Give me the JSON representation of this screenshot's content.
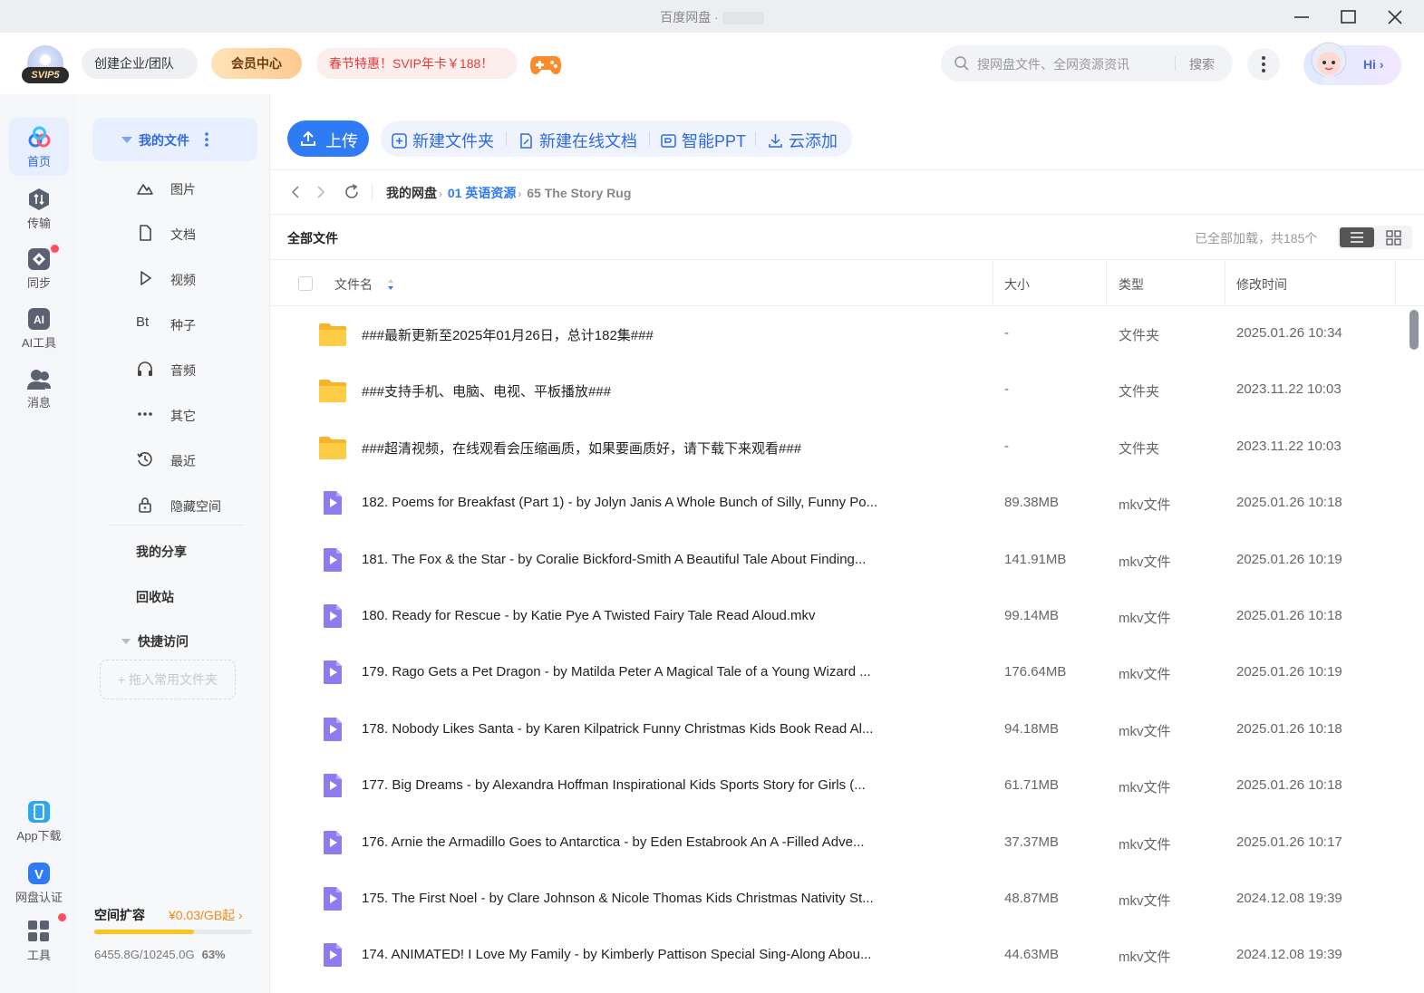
{
  "window": {
    "title": "百度网盘 ·",
    "controls": [
      "minimize-icon",
      "maximize-icon",
      "close-icon"
    ]
  },
  "header": {
    "svip_label": "SVIP5",
    "create_team": "创建企业/团队",
    "vip_center": "会员中心",
    "promo": "春节特惠！SVIP年卡￥188！",
    "search_placeholder": "搜网盘文件、全网资源资讯",
    "search_button": "搜索",
    "hi_label": "Hi"
  },
  "rail": {
    "items": [
      {
        "label": "首页",
        "icon": "home-icon"
      },
      {
        "label": "传输",
        "icon": "transfer-icon"
      },
      {
        "label": "同步",
        "icon": "sync-icon"
      },
      {
        "label": "AI工具",
        "icon": "ai-tools-icon"
      },
      {
        "label": "消息",
        "icon": "messages-icon"
      }
    ],
    "bottom": [
      {
        "label": "App下载",
        "icon": "app-download-icon"
      },
      {
        "label": "网盘认证",
        "icon": "verify-icon"
      },
      {
        "label": "工具",
        "icon": "tools-icon"
      }
    ]
  },
  "nav": {
    "my_files": "我的文件",
    "items": [
      {
        "label": "图片",
        "icon": "image-icon"
      },
      {
        "label": "文档",
        "icon": "document-icon"
      },
      {
        "label": "视频",
        "icon": "video-icon"
      },
      {
        "label": "种子",
        "icon": "torrent-icon"
      },
      {
        "label": "音频",
        "icon": "audio-icon"
      },
      {
        "label": "其它",
        "icon": "other-icon"
      },
      {
        "label": "最近",
        "icon": "recent-icon"
      },
      {
        "label": "隐藏空间",
        "icon": "lock-icon"
      }
    ],
    "torrent_glyph": "Bt",
    "my_share": "我的分享",
    "recycle": "回收站",
    "quick_access": "快捷访问",
    "drop_hint": "+ 拖入常用文件夹",
    "space": {
      "title": "空间扩容",
      "price": "¥0.03/GB起",
      "usage": "6455.8G/10245.0G",
      "percent_label": "63%",
      "percent": 63
    }
  },
  "toolbar": {
    "upload": "上传",
    "new_folder": "新建文件夹",
    "new_doc": "新建在线文档",
    "smart_ppt": "智能PPT",
    "cloud_add": "云添加"
  },
  "breadcrumb": {
    "root": "我的网盘",
    "level1": "01 英语资源",
    "current": "65 The Story Rug"
  },
  "list": {
    "title": "全部文件",
    "count": "已全部加载，共185个",
    "columns": {
      "name": "文件名",
      "size": "大小",
      "type": "类型",
      "modified": "修改时间"
    },
    "rows": [
      {
        "kind": "folder",
        "name": "###最新更新至2025年01月26日，总计182集###",
        "size": "-",
        "type": "文件夹",
        "modified": "2025.01.26 10:34"
      },
      {
        "kind": "folder",
        "name": "###支持手机、电脑、电视、平板播放###",
        "size": "-",
        "type": "文件夹",
        "modified": "2023.11.22 10:03"
      },
      {
        "kind": "folder",
        "name": "###超清视频，在线观看会压缩画质，如果要画质好，请下载下来观看###",
        "size": "-",
        "type": "文件夹",
        "modified": "2023.11.22 10:03"
      },
      {
        "kind": "video",
        "name": "182. Poems for Breakfast (Part 1) - by Jolyn Janis A Whole Bunch of Silly, Funny Po...",
        "size": "89.38MB",
        "type": "mkv文件",
        "modified": "2025.01.26 10:18"
      },
      {
        "kind": "video",
        "name": "181. The Fox & the Star - by Coralie Bickford-Smith A Beautiful Tale About Finding...",
        "size": "141.91MB",
        "type": "mkv文件",
        "modified": "2025.01.26 10:19"
      },
      {
        "kind": "video",
        "name": "180. Ready for Rescue - by Katie Pye A Twisted Fairy Tale Read Aloud.mkv",
        "size": "99.14MB",
        "type": "mkv文件",
        "modified": "2025.01.26 10:18"
      },
      {
        "kind": "video",
        "name": "179. Rago Gets a Pet Dragon - by Matilda Peter A Magical Tale of a Young Wizard ...",
        "size": "176.64MB",
        "type": "mkv文件",
        "modified": "2025.01.26 10:19"
      },
      {
        "kind": "video",
        "name": "178. Nobody Likes Santa - by Karen Kilpatrick Funny Christmas Kids Book Read Al...",
        "size": "94.18MB",
        "type": "mkv文件",
        "modified": "2025.01.26 10:18"
      },
      {
        "kind": "video",
        "name": "177. Big Dreams - by Alexandra Hoffman Inspirational Kids Sports Story for Girls (...",
        "size": "61.71MB",
        "type": "mkv文件",
        "modified": "2025.01.26 10:18"
      },
      {
        "kind": "video",
        "name": "176. Arnie the Armadillo Goes to Antarctica - by Eden Estabrook An A -Filled Adve...",
        "size": "37.37MB",
        "type": "mkv文件",
        "modified": "2025.01.26 10:17"
      },
      {
        "kind": "video",
        "name": "175. The First Noel - by Clare Johnson & Nicole Thomas Kids Christmas Nativity St...",
        "size": "48.87MB",
        "type": "mkv文件",
        "modified": "2024.12.08 19:39"
      },
      {
        "kind": "video",
        "name": "174. ANIMATED! I Love My Family - by Kimberly Pattison Special Sing-Along Abou...",
        "size": "44.63MB",
        "type": "mkv文件",
        "modified": "2024.12.08 19:39"
      }
    ]
  },
  "colors": {
    "accent": "#2f7bf5",
    "folder": "#ffc83d",
    "video": "#8c7cf0",
    "promo": "#e63a3a",
    "space_fill": "#ffc21a"
  }
}
